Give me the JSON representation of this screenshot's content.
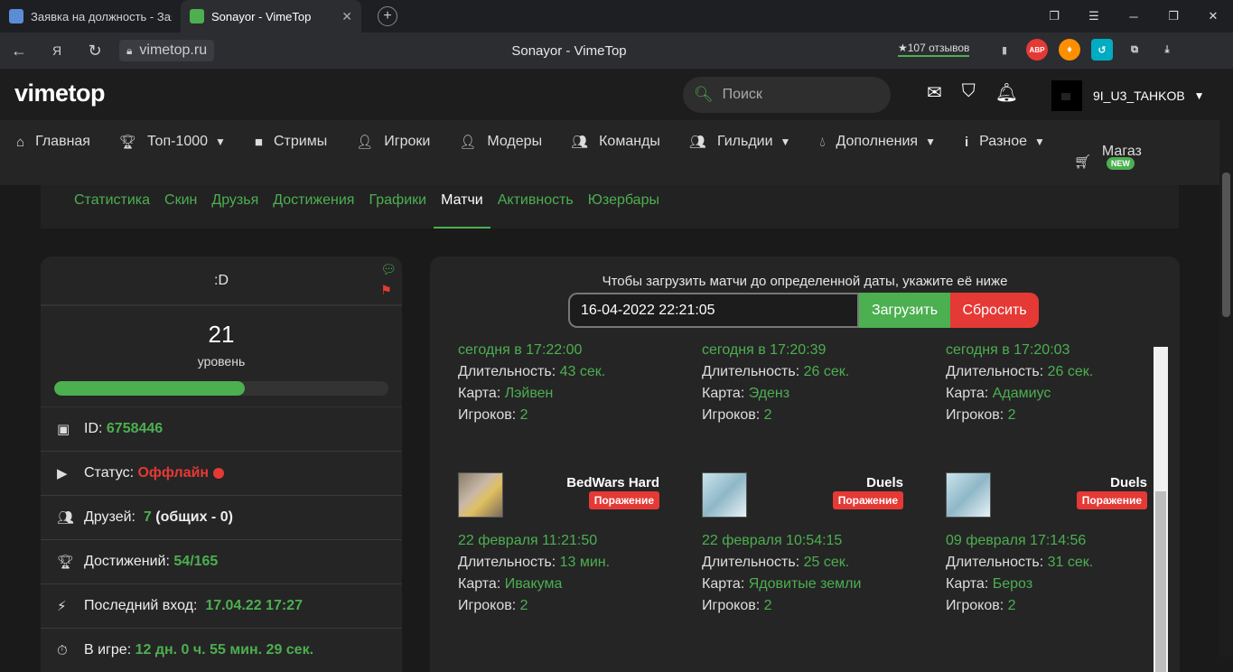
{
  "browser": {
    "tabs": [
      {
        "title": "Заявка на должность - Заявки"
      },
      {
        "title": "Sonayor - VimeTop"
      }
    ],
    "url": "vimetop.ru",
    "page_title": "Sonayor - VimeTop",
    "reviews": "★107 отзывов",
    "ext_abp": "ABP"
  },
  "site": {
    "logo": "vimetop",
    "search_placeholder": "Поиск",
    "username": "9I_U3_TAHKOB",
    "nav": [
      {
        "label": "Главная",
        "icon": "home-icon"
      },
      {
        "label": "Топ-1000",
        "icon": "trophy-icon"
      },
      {
        "label": "Стримы",
        "icon": "video-icon"
      },
      {
        "label": "Игроки",
        "icon": "user-plus-icon"
      },
      {
        "label": "Модеры",
        "icon": "user-shield-icon"
      },
      {
        "label": "Команды",
        "icon": "users-icon"
      },
      {
        "label": "Гильдии",
        "icon": "guild-icon"
      },
      {
        "label": "Дополнения",
        "icon": "drop-icon"
      },
      {
        "label": "Разное",
        "icon": "info-icon"
      },
      {
        "label": "Магаз",
        "icon": "cart-icon"
      }
    ],
    "new_badge": "NEW"
  },
  "subtabs": [
    "Статистика",
    "Скин",
    "Друзья",
    "Достижения",
    "Графики",
    "Матчи",
    "Активность",
    "Юзербары"
  ],
  "active_subtab": "Матчи",
  "profile": {
    "status_text": ":D",
    "level": "21",
    "level_label": "уровень",
    "level_progress": 0.57,
    "id_label": "ID:",
    "id_value": "6758446",
    "status_label": "Статус:",
    "status_value": "Оффлайн",
    "friends_label": "Друзей:",
    "friends_value": "7",
    "friends_common": "(общих - 0)",
    "achievements_label": "Достижений:",
    "achievements_value": "54/165",
    "last_login_label": "Последний вход:",
    "last_login_value": "17.04.22 17:27",
    "playtime_label": "В игре:",
    "playtime_value": "12 дн. 0 ч. 55 мин. 29 сек."
  },
  "matches": {
    "hint": "Чтобы загрузить матчи до определенной даты, укажите её ниже",
    "date_value": "16-04-2022 22:21:05",
    "load_label": "Загрузить",
    "reset_label": "Сбросить",
    "labels": {
      "duration": "Длительность:",
      "map": "Карта:",
      "players": "Игроков:"
    },
    "top_row": [
      {
        "date": "сегодня в 17:22:00",
        "duration": "43 сек.",
        "map": "Лэйвен",
        "players": "2"
      },
      {
        "date": "сегодня в 17:20:39",
        "duration": "26 сек.",
        "map": "Эденз",
        "players": "2"
      },
      {
        "date": "сегодня в 17:20:03",
        "duration": "26 сек.",
        "map": "Адамиус",
        "players": "2"
      }
    ],
    "bottom_row": [
      {
        "mode": "BedWars Hard",
        "result": "Поражение",
        "date": "22 февраля 11:21:50",
        "duration": "13 мин.",
        "map": "Ивакума",
        "players": "2"
      },
      {
        "mode": "Duels",
        "result": "Поражение",
        "date": "22 февраля 10:54:15",
        "duration": "25 сек.",
        "map": "Ядовитые земли",
        "players": "2"
      },
      {
        "mode": "Duels",
        "result": "Поражение",
        "date": "09 февраля 17:14:56",
        "duration": "31 сек.",
        "map": "Берoз",
        "players": "2"
      }
    ]
  }
}
